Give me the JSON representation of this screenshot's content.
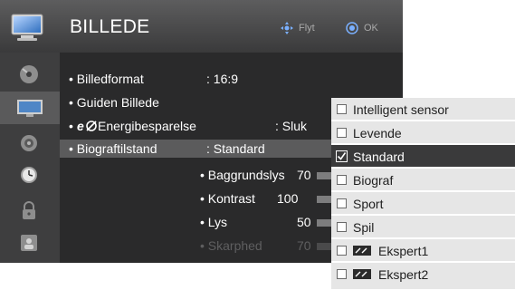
{
  "header": {
    "title": "BILLEDE",
    "hint_move": "Flyt",
    "hint_ok": "OK"
  },
  "rail": {
    "items": [
      {
        "icon": "disc-icon",
        "selected": false
      },
      {
        "icon": "tv-picture-icon",
        "selected": true
      },
      {
        "icon": "speaker-icon",
        "selected": false
      },
      {
        "icon": "clock-icon",
        "selected": false
      },
      {
        "icon": "lock-icon",
        "selected": false
      },
      {
        "icon": "options-icon",
        "selected": false
      }
    ]
  },
  "settings": [
    {
      "label": "• Billedformat",
      "value": ": 16:9"
    },
    {
      "label": "• Guiden Billede",
      "value": ""
    },
    {
      "label": "• ",
      "label_icon": "energy-saving-icon",
      "label_rest": "Energibesparelse",
      "value": ": Sluk"
    },
    {
      "label": "• Biograftilstand",
      "value": ": Standard",
      "selected": true
    }
  ],
  "sub_settings": [
    {
      "label": "• Baggrundslys",
      "value": "70",
      "level": 70
    },
    {
      "label": "• Kontrast",
      "value": "100",
      "level": 100
    },
    {
      "label": "• Lys",
      "value": "50",
      "level": 50
    },
    {
      "label": "• Skarphed",
      "value": "70",
      "level": 70,
      "faded": true
    }
  ],
  "dropdown": {
    "options": [
      {
        "label": "Intelligent sensor",
        "checked": false
      },
      {
        "label": "Levende",
        "checked": false
      },
      {
        "label": "Standard",
        "checked": true
      },
      {
        "label": "Biograf",
        "checked": false
      },
      {
        "label": "Sport",
        "checked": false
      },
      {
        "label": "Spil",
        "checked": false
      },
      {
        "label": "Ekspert1",
        "checked": false,
        "icon": "expert-icon"
      },
      {
        "label": "Ekspert2",
        "checked": false,
        "icon": "expert-icon"
      }
    ]
  },
  "colors": {
    "panel": "#2a2a2b",
    "rail": "#3e3e3f",
    "selected_row": "#5b5b5c",
    "dropdown_bg": "#e6e6e6",
    "dropdown_selected": "#3a3a3b",
    "level_bar": "#7d7d7e"
  }
}
